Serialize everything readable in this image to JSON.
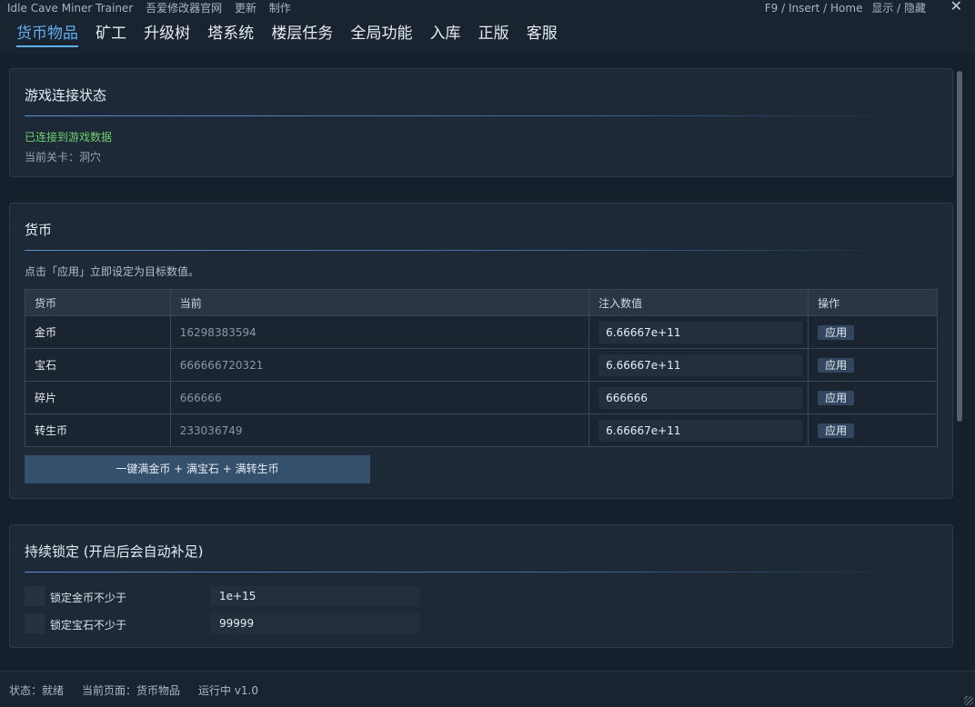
{
  "titlebar": {
    "app_name": "Idle Cave Miner Trainer",
    "links": [
      "吾爱修改器官网",
      "更新",
      "制作"
    ],
    "hotkeys": "F9 / Insert / Home",
    "toggle_label": "显示 / 隐藏",
    "close_glyph": "✕"
  },
  "tabs": [
    "货币物品",
    "矿工",
    "升级树",
    "塔系统",
    "楼层任务",
    "全局功能",
    "入库",
    "正版",
    "客服"
  ],
  "active_tab": "货币物品",
  "connection": {
    "title": "游戏连接状态",
    "status": "已连接到游戏数据",
    "level": "当前关卡：洞穴"
  },
  "currency": {
    "title": "货币",
    "hint": "点击「应用」立即设定为目标数值。",
    "columns": [
      "货币",
      "当前",
      "注入数值",
      "操作"
    ],
    "rows": [
      {
        "name": "金币",
        "current": "16298383594",
        "inject": "6.66667e+11",
        "action": "应用"
      },
      {
        "name": "宝石",
        "current": "666666720321",
        "inject": "6.66667e+11",
        "action": "应用"
      },
      {
        "name": "碎片",
        "current": "666666",
        "inject": "666666",
        "action": "应用"
      },
      {
        "name": "转生币",
        "current": "233036749",
        "inject": "6.66667e+11",
        "action": "应用"
      }
    ],
    "fill_all_button": "一键满金币 + 满宝石 + 满转生币"
  },
  "lock": {
    "title": "持续锁定 (开启后会自动补足)",
    "items": [
      {
        "label": "锁定金币不少于",
        "value": "1e+15"
      },
      {
        "label": "锁定宝石不少于",
        "value": "99999"
      }
    ]
  },
  "footer": {
    "status": "状态：就绪",
    "page": "当前页面：货币物品",
    "running": "运行中  v1.0"
  },
  "colors": {
    "accent": "#5fb0f0",
    "connected": "#6fd06f",
    "background": "#1a2330"
  }
}
